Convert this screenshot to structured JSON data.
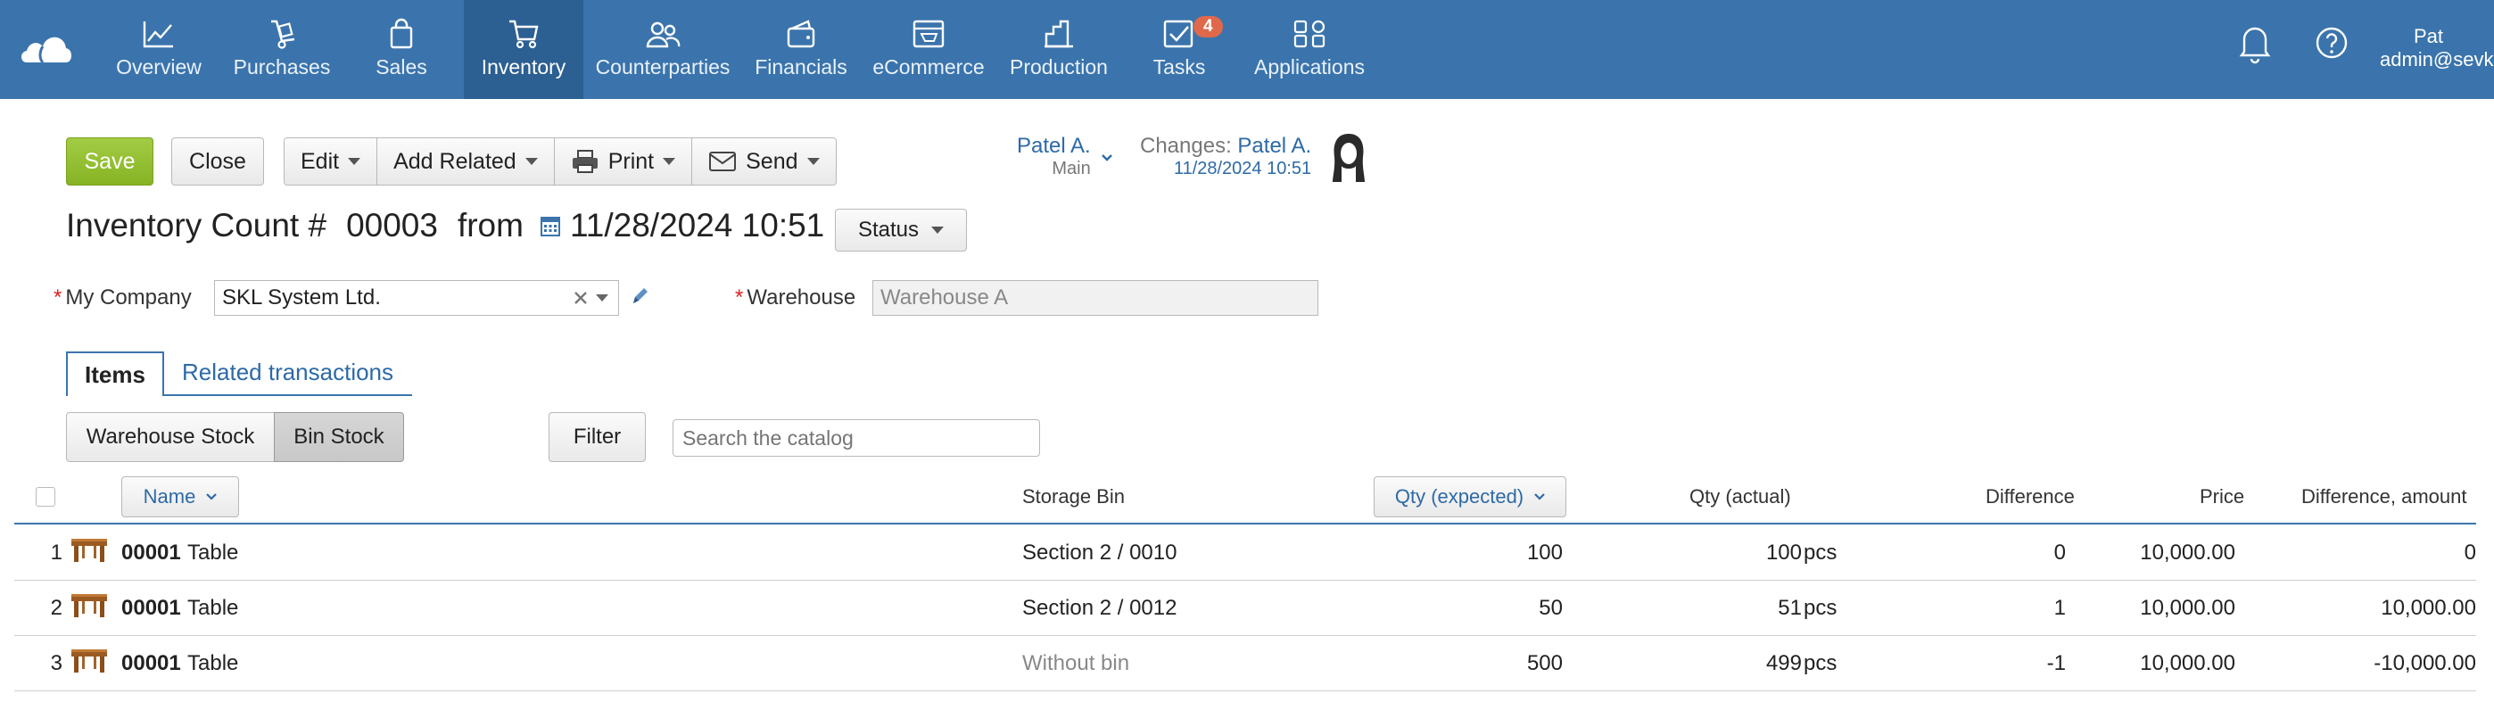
{
  "nav": {
    "items": [
      {
        "label": "Overview",
        "icon": "chart-line-icon"
      },
      {
        "label": "Purchases",
        "icon": "hand-truck-icon"
      },
      {
        "label": "Sales",
        "icon": "shopping-bag-icon"
      },
      {
        "label": "Inventory",
        "icon": "cart-icon",
        "active": true
      },
      {
        "label": "Counterparties",
        "icon": "people-icon"
      },
      {
        "label": "Financials",
        "icon": "wallet-icon"
      },
      {
        "label": "eCommerce",
        "icon": "storefront-icon"
      },
      {
        "label": "Production",
        "icon": "factory-icon"
      },
      {
        "label": "Tasks",
        "icon": "checkbox-icon",
        "badge": "4"
      },
      {
        "label": "Applications",
        "icon": "apps-grid-icon"
      }
    ],
    "user_name": "Pat",
    "user_email": "admin@sevka"
  },
  "toolbar": {
    "save": "Save",
    "close": "Close",
    "edit": "Edit",
    "add_related": "Add Related",
    "print": "Print",
    "send": "Send"
  },
  "owner": {
    "name": "Patel A.",
    "department": "Main"
  },
  "changes": {
    "label": "Changes:",
    "name": "Patel A.",
    "timestamp": "11/28/2024 10:51"
  },
  "doc": {
    "title": "Inventory Count #",
    "number": "00003",
    "from": "from",
    "datetime": "11/28/2024 10:51",
    "status": "Status"
  },
  "fields": {
    "company_label": "My Company",
    "company_value": "SKL System Ltd.",
    "warehouse_label": "Warehouse",
    "warehouse_placeholder": "Warehouse A"
  },
  "tabs": {
    "items": "Items",
    "related": "Related transactions"
  },
  "subbar": {
    "warehouse_stock": "Warehouse Stock",
    "bin_stock": "Bin Stock",
    "filter": "Filter",
    "search_placeholder": "Search the catalog"
  },
  "table": {
    "headers": {
      "name": "Name",
      "bin": "Storage Bin",
      "qty_expected": "Qty (expected)",
      "qty_actual": "Qty (actual)",
      "difference": "Difference",
      "price": "Price",
      "diff_amount": "Difference, amount"
    },
    "rows": [
      {
        "n": "1",
        "code": "00001",
        "name": "Table",
        "bin": "Section 2 / 0010",
        "expected": "100",
        "actual": "100",
        "unit": "pcs",
        "diff": "0",
        "price": "10,000.00",
        "amount": "0",
        "bin_muted": false
      },
      {
        "n": "2",
        "code": "00001",
        "name": "Table",
        "bin": "Section 2 / 0012",
        "expected": "50",
        "actual": "51",
        "unit": "pcs",
        "diff": "1",
        "price": "10,000.00",
        "amount": "10,000.00",
        "bin_muted": false
      },
      {
        "n": "3",
        "code": "00001",
        "name": "Table",
        "bin": "Without bin",
        "expected": "500",
        "actual": "499",
        "unit": "pcs",
        "diff": "-1",
        "price": "10,000.00",
        "amount": "-10,000.00",
        "bin_muted": true
      }
    ]
  },
  "colors": {
    "header": "#3b74ac",
    "active_nav": "#2c5f92",
    "save": "#8fbb2e",
    "badge": "#e1694b",
    "link": "#2d6aa6"
  }
}
